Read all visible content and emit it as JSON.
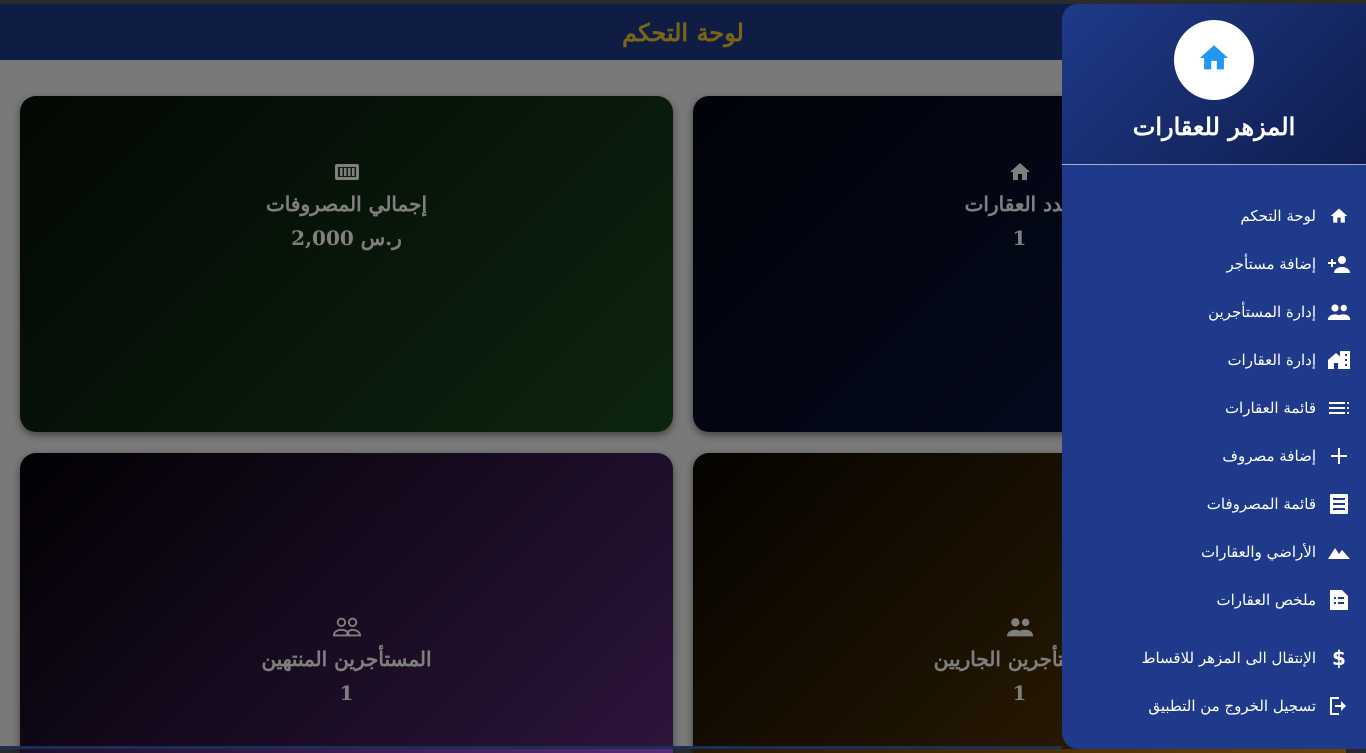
{
  "topbar": {
    "title": "لوحة التحكم"
  },
  "cards": {
    "expenses": {
      "title": "إجمالي المصروفات",
      "value": "2,000 ر.س",
      "icon": "money-icon"
    },
    "properties": {
      "title": "عدد العقارات",
      "value": "1",
      "icon": "home-icon"
    },
    "ended_tenants": {
      "title": "المستأجرين المنتهين",
      "value": "1",
      "icon": "people-outline-icon"
    },
    "current_tenants": {
      "title": "المستأجرين الجاريين",
      "value": "1",
      "icon": "people-icon"
    }
  },
  "drawer": {
    "brand": "المزهر للعقارات",
    "logo_icon": "home-icon",
    "items": [
      {
        "label": "لوحة التحكم",
        "icon": "home-icon"
      },
      {
        "label": "إضافة مستأجر",
        "icon": "person-add-icon"
      },
      {
        "label": "إدارة المستأجرين",
        "icon": "people-icon"
      },
      {
        "label": "إدارة العقارات",
        "icon": "buildings-icon"
      },
      {
        "label": "قائمة العقارات",
        "icon": "list-icon"
      },
      {
        "label": "إضافة مصروف",
        "icon": "plus-icon"
      },
      {
        "label": "قائمة المصروفات",
        "icon": "receipt-icon"
      },
      {
        "label": "الأراضي والعقارات",
        "icon": "landscape-icon"
      },
      {
        "label": "ملخص العقارات",
        "icon": "summary-icon"
      },
      {
        "label": "الإنتقال الى المزهر للاقساط",
        "icon": "dollar-icon"
      },
      {
        "label": "تسجيل الخروج من التطبيق",
        "icon": "logout-icon"
      }
    ]
  },
  "colors": {
    "primary": "#1f3a8a",
    "accent": "#f2c832",
    "logo_icon": "#2196f3"
  }
}
